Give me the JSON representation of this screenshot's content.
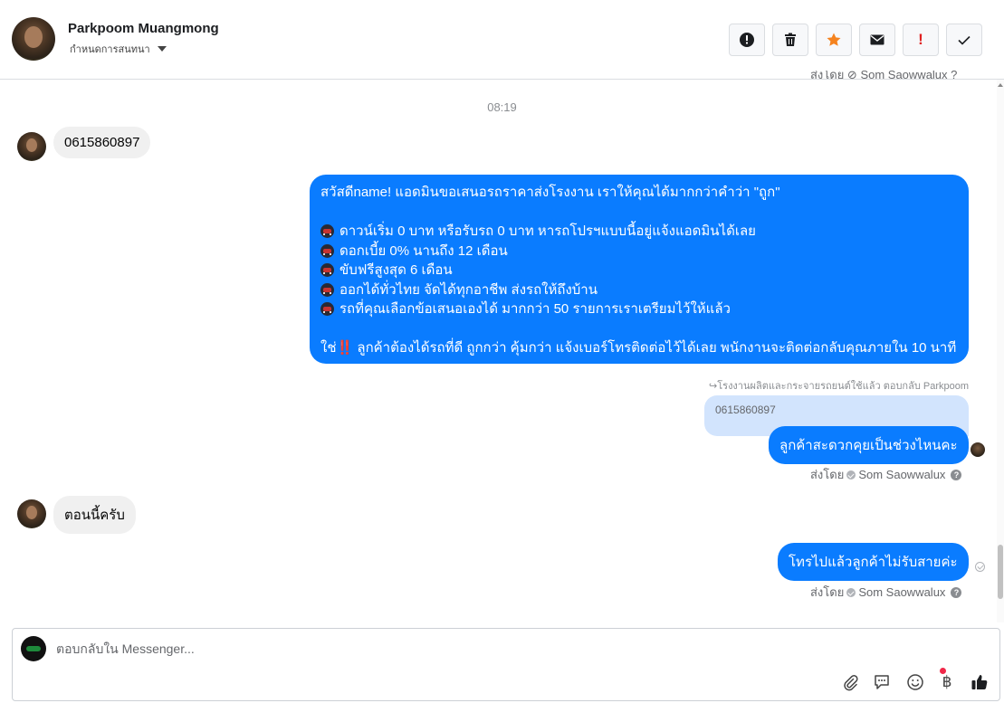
{
  "header": {
    "contact_name": "Parkpoom Muangmong",
    "sub_label": "กำหนดการสนทนา",
    "buttons": {
      "spam_icon": "alert-circle-icon",
      "delete_icon": "trash-icon",
      "star_icon": "star-icon",
      "mail_icon": "envelope-icon",
      "important_label": "!",
      "done_icon": "check-icon"
    }
  },
  "conversation": {
    "clipped_top_text": "ส่งโดย ⊘ Som Saowwalux ?",
    "time_separator": "08:19",
    "incoming_1": "0615860897",
    "outgoing_long": {
      "line1": "สวัสดีname! แอดมินขอเสนอรถราคาส่งโรงงาน เราให้คุณได้มากกว่าคำว่า \"ถูก\"",
      "bullet1": "ดาวน์เริ่ม 0 บาท หรือรับรถ 0 บาท หารถโปรฯแบบนี้อยู่แจ้งแอดมินได้เลย",
      "bullet2": "ดอกเบี้ย 0% นานถึง 12 เดือน",
      "bullet3": "ขับฟรีสูงสุด 6 เดือน",
      "bullet4": "ออกได้ทั่วไทย จัดได้ทุกอาชีพ ส่งรถให้ถึงบ้าน",
      "bullet5": "รถที่คุณเลือกข้อเสนอเองได้ มากกว่า 50 รายการเราเตรียมไว้ให้แล้ว",
      "closing_pre": "ใช่",
      "closing_bang": "‼️",
      "closing_post": " ลูกค้าต้องได้รถที่ดี ถูกกว่า คุ้มกว่า แจ้งเบอร์โทรติดต่อไว้ได้เลย พนักงานจะติดต่อกลับคุณภายใน 10 นาที"
    },
    "reply_note": "↪โรงงานผลิตและกระจายรถยนต์ใช้แล้ว ตอบกลับ Parkpoom",
    "quoted_text": "0615860897",
    "outgoing_2": "ลูกค้าสะดวกคุยเป็นช่วงไหนคะ",
    "sent_by_prefix": "ส่งโดย",
    "sent_by_name": "Som Saowwalux",
    "help_mark": "?",
    "incoming_2": "ตอนนี้ครับ",
    "outgoing_3": "โทรไปแล้วลูกค้าไม่รับสายค่ะ"
  },
  "composer": {
    "placeholder": "ตอบกลับใน Messenger...",
    "tools": [
      "paperclip-icon",
      "saved-replies-icon",
      "emoji-icon",
      "baht-icon",
      "thumbs-up-icon"
    ],
    "baht_symbol": "฿"
  },
  "colors": {
    "accent_blue": "#0a7cff",
    "quoted_bg": "#d2e4fd",
    "incoming_bg": "#f0f0f0",
    "star_orange": "#f5831f",
    "important_red": "#e02020",
    "notification_red": "#f02849"
  }
}
